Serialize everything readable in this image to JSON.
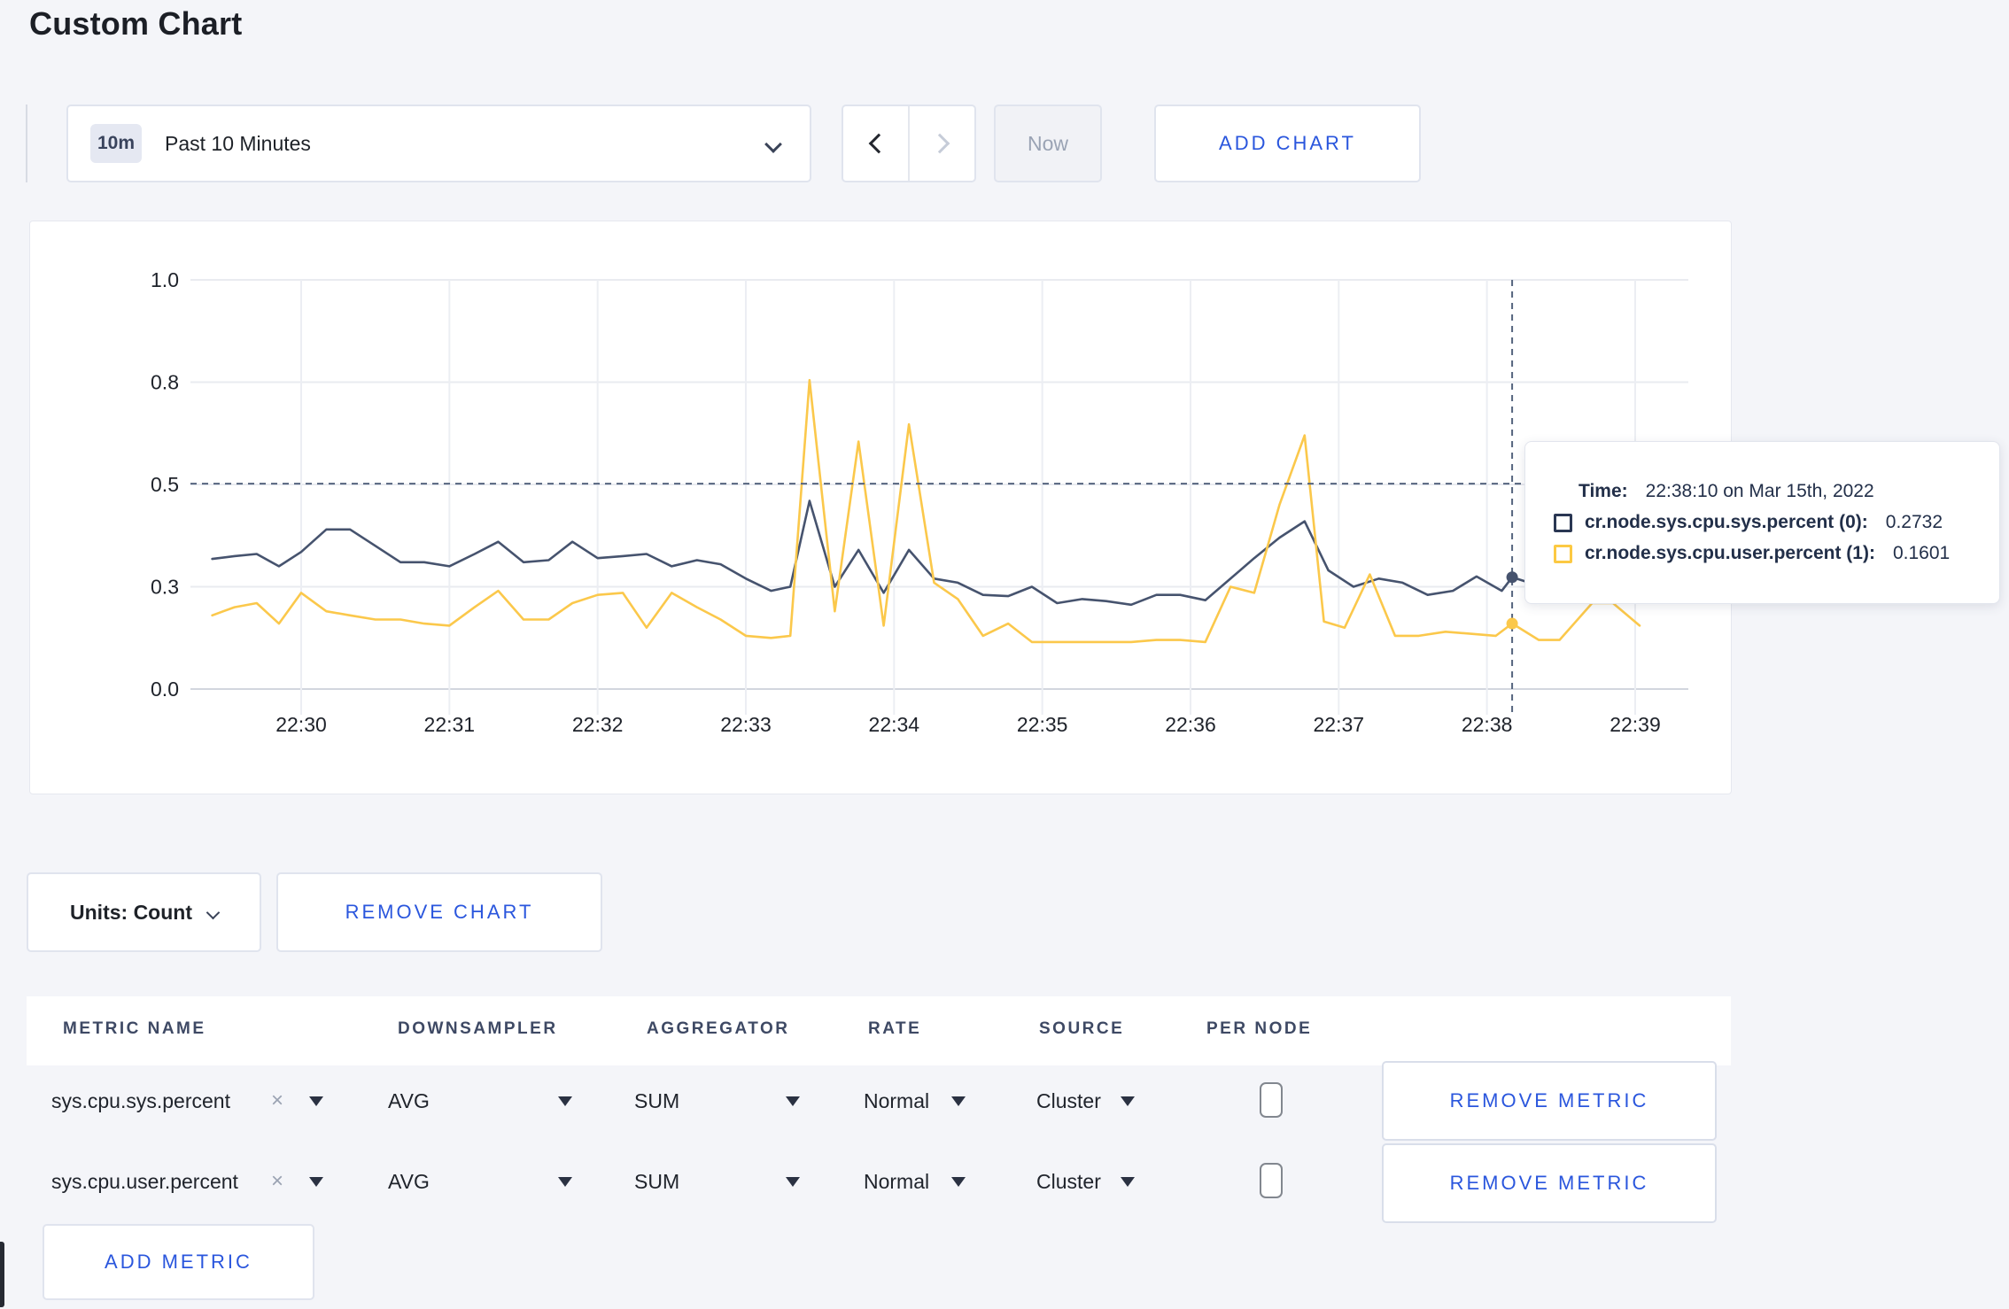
{
  "page": {
    "title": "Custom Chart"
  },
  "toolbar": {
    "timeframe_badge": "10m",
    "timeframe_label": "Past 10 Minutes",
    "now_label": "Now",
    "add_chart_label": "ADD CHART"
  },
  "chart_data": {
    "type": "line",
    "title": "",
    "xlabel": "",
    "ylabel": "",
    "ylim": [
      0,
      1
    ],
    "grid": true,
    "legend_position": "tooltip-only",
    "x_axis": {
      "tick_labels": [
        "22:30",
        "22:31",
        "22:32",
        "22:33",
        "22:34",
        "22:35",
        "22:36",
        "22:37",
        "22:38",
        "22:39"
      ],
      "tick_minutes": [
        0,
        1,
        2,
        3,
        4,
        5,
        6,
        7,
        8,
        9
      ],
      "note": "x expressed as minutes after 22:30 on Mar 15th, 2022"
    },
    "y_axis": {
      "ticks": [
        {
          "label": "0.0",
          "value": 0
        },
        {
          "label": "0.3",
          "value": 0.25
        },
        {
          "label": "0.5",
          "value": 0.5
        },
        {
          "label": "0.8",
          "value": 0.75
        },
        {
          "label": "1.0",
          "value": 1.0
        }
      ],
      "note": "gridlines sit at 0, .25, .5, .75, 1.0; labels shown rounded to one decimal"
    },
    "series": [
      {
        "name": "cr.node.sys.cpu.sys.percent (0)",
        "color": "#46536E",
        "points": [
          [
            -0.6,
            0.318
          ],
          [
            -0.45,
            0.325
          ],
          [
            -0.3,
            0.33
          ],
          [
            -0.15,
            0.3
          ],
          [
            0,
            0.335
          ],
          [
            0.17,
            0.39
          ],
          [
            0.33,
            0.39
          ],
          [
            0.5,
            0.35
          ],
          [
            0.67,
            0.31
          ],
          [
            0.83,
            0.31
          ],
          [
            1.0,
            0.3
          ],
          [
            1.17,
            0.33
          ],
          [
            1.33,
            0.36
          ],
          [
            1.5,
            0.31
          ],
          [
            1.67,
            0.315
          ],
          [
            1.83,
            0.36
          ],
          [
            2.0,
            0.32
          ],
          [
            2.17,
            0.325
          ],
          [
            2.33,
            0.33
          ],
          [
            2.5,
            0.3
          ],
          [
            2.67,
            0.315
          ],
          [
            2.83,
            0.305
          ],
          [
            3.0,
            0.27
          ],
          [
            3.17,
            0.24
          ],
          [
            3.3,
            0.25
          ],
          [
            3.43,
            0.46
          ],
          [
            3.6,
            0.25
          ],
          [
            3.76,
            0.34
          ],
          [
            3.93,
            0.235
          ],
          [
            4.1,
            0.34
          ],
          [
            4.27,
            0.27
          ],
          [
            4.43,
            0.26
          ],
          [
            4.6,
            0.23
          ],
          [
            4.77,
            0.227
          ],
          [
            4.93,
            0.25
          ],
          [
            5.1,
            0.21
          ],
          [
            5.27,
            0.22
          ],
          [
            5.43,
            0.215
          ],
          [
            5.6,
            0.206
          ],
          [
            5.77,
            0.23
          ],
          [
            5.93,
            0.23
          ],
          [
            6.1,
            0.217
          ],
          [
            6.27,
            0.27
          ],
          [
            6.43,
            0.32
          ],
          [
            6.6,
            0.37
          ],
          [
            6.77,
            0.41
          ],
          [
            6.93,
            0.29
          ],
          [
            7.1,
            0.25
          ],
          [
            7.27,
            0.27
          ],
          [
            7.43,
            0.26
          ],
          [
            7.6,
            0.23
          ],
          [
            7.77,
            0.24
          ],
          [
            7.93,
            0.275
          ],
          [
            8.1,
            0.24
          ],
          [
            8.17,
            0.2732
          ],
          [
            8.33,
            0.255
          ],
          [
            8.5,
            0.26
          ],
          [
            8.67,
            0.275
          ],
          [
            8.83,
            0.29
          ],
          [
            9.0,
            0.3
          ]
        ]
      },
      {
        "name": "cr.node.sys.cpu.user.percent (1)",
        "color": "#FBC84B",
        "points": [
          [
            -0.6,
            0.18
          ],
          [
            -0.45,
            0.2
          ],
          [
            -0.3,
            0.21
          ],
          [
            -0.15,
            0.16
          ],
          [
            0,
            0.235
          ],
          [
            0.17,
            0.19
          ],
          [
            0.33,
            0.18
          ],
          [
            0.5,
            0.17
          ],
          [
            0.67,
            0.17
          ],
          [
            0.83,
            0.16
          ],
          [
            1.0,
            0.155
          ],
          [
            1.17,
            0.2
          ],
          [
            1.33,
            0.24
          ],
          [
            1.5,
            0.17
          ],
          [
            1.67,
            0.17
          ],
          [
            1.83,
            0.21
          ],
          [
            2.0,
            0.23
          ],
          [
            2.17,
            0.235
          ],
          [
            2.33,
            0.15
          ],
          [
            2.5,
            0.235
          ],
          [
            2.67,
            0.2
          ],
          [
            2.83,
            0.17
          ],
          [
            3.0,
            0.13
          ],
          [
            3.17,
            0.125
          ],
          [
            3.3,
            0.13
          ],
          [
            3.43,
            0.755
          ],
          [
            3.6,
            0.19
          ],
          [
            3.76,
            0.605
          ],
          [
            3.93,
            0.155
          ],
          [
            4.1,
            0.647
          ],
          [
            4.27,
            0.26
          ],
          [
            4.43,
            0.22
          ],
          [
            4.6,
            0.13
          ],
          [
            4.77,
            0.16
          ],
          [
            4.93,
            0.115
          ],
          [
            5.1,
            0.115
          ],
          [
            5.27,
            0.115
          ],
          [
            5.43,
            0.115
          ],
          [
            5.6,
            0.115
          ],
          [
            5.77,
            0.12
          ],
          [
            5.93,
            0.12
          ],
          [
            6.1,
            0.115
          ],
          [
            6.27,
            0.25
          ],
          [
            6.43,
            0.235
          ],
          [
            6.6,
            0.45
          ],
          [
            6.77,
            0.62
          ],
          [
            6.9,
            0.165
          ],
          [
            7.04,
            0.15
          ],
          [
            7.21,
            0.28
          ],
          [
            7.38,
            0.13
          ],
          [
            7.54,
            0.13
          ],
          [
            7.72,
            0.14
          ],
          [
            7.89,
            0.135
          ],
          [
            8.06,
            0.13
          ],
          [
            8.17,
            0.1601
          ],
          [
            8.35,
            0.12
          ],
          [
            8.49,
            0.12
          ],
          [
            8.71,
            0.21
          ],
          [
            8.85,
            0.21
          ],
          [
            9.03,
            0.155
          ]
        ]
      }
    ],
    "hover": {
      "time_minutes": 8.17,
      "crosshair_value": 0.502,
      "points": [
        {
          "series": 0,
          "value": 0.2732
        },
        {
          "series": 1,
          "value": 0.1601
        }
      ]
    }
  },
  "tooltip": {
    "time_label": "Time:",
    "time_value": "22:38:10 on Mar 15th, 2022",
    "rows": [
      {
        "name": "cr.node.sys.cpu.sys.percent (0):",
        "value": "0.2732",
        "swatch_color": "#2A3753"
      },
      {
        "name": "cr.node.sys.cpu.user.percent (1):",
        "value": "0.1601",
        "swatch_color": "#FCC943"
      }
    ]
  },
  "chart_controls": {
    "units_label": "Units: Count",
    "remove_chart_label": "REMOVE CHART"
  },
  "metrics_table": {
    "headers": [
      "METRIC NAME",
      "DOWNSAMPLER",
      "AGGREGATOR",
      "RATE",
      "SOURCE",
      "PER NODE"
    ],
    "remove_icon": "×",
    "rows": [
      {
        "name": "sys.cpu.sys.percent",
        "downsampler": "AVG",
        "aggregator": "SUM",
        "rate": "Normal",
        "source": "Cluster",
        "per_node_checked": false,
        "remove_label": "REMOVE METRIC"
      },
      {
        "name": "sys.cpu.user.percent",
        "downsampler": "AVG",
        "aggregator": "SUM",
        "rate": "Normal",
        "source": "Cluster",
        "per_node_checked": false,
        "remove_label": "REMOVE METRIC"
      }
    ],
    "add_metric_label": "ADD METRIC"
  },
  "colors": {
    "accent_blue": "#2A56DD",
    "series_blue": "#46536E",
    "series_yellow": "#FBC84B",
    "page_bg": "#F4F5F9",
    "crosshair": "#55647E"
  }
}
